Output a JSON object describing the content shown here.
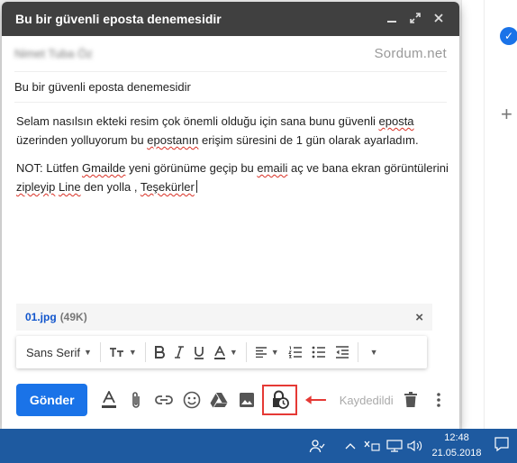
{
  "compose": {
    "title": "Bu bir güvenli eposta denemesidir",
    "to_name": "Nimet Tuba Öz",
    "watermark": "Sordum.net",
    "subject": "Bu bir güvenli eposta denemesidir",
    "body": {
      "p1_part1": "Selam nasılsın ekteki resim çok önemli olduğu için sana bunu güvenli ",
      "p1_sq1": "eposta",
      "p1_part2": " üzerinden yolluyorum bu ",
      "p1_sq2": "epostanın",
      "p1_part3": " erişim süresini de 1 gün olarak ayarladım.",
      "p2_part1": "NOT: Lütfen ",
      "p2_sq1": "Gmailde",
      "p2_part2": " yeni görünüme geçip bu ",
      "p2_sq2": "emaili",
      "p2_part3": " aç ve bana ekran görüntülerini ",
      "p2_sq3": "zipleyip",
      "p2_part4": " ",
      "p2_sq4": "Line",
      "p2_part5": " den yolla , ",
      "p2_sq5": "Teşekürler"
    },
    "attachment": {
      "name": "01.jpg",
      "size": "(49K)",
      "close": "×"
    },
    "format": {
      "font": "Sans Serif"
    },
    "send_label": "Gönder",
    "saved_label": "Kaydedildi"
  },
  "taskbar": {
    "time": "12:48",
    "date": "21.05.2018"
  },
  "colors": {
    "send": "#1a73e8",
    "highlight": "#e53935",
    "titlebar": "#404040",
    "taskbar": "#1e5aa0"
  }
}
